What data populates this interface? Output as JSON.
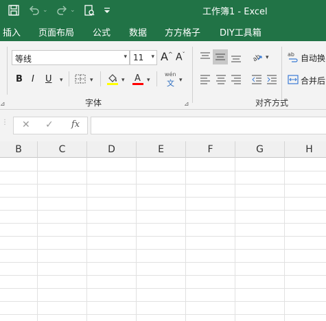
{
  "titlebar": {
    "doc_title": "工作簿1 - Excel",
    "quick_access": [
      "save-icon",
      "undo-icon",
      "redo-icon",
      "print-preview-icon",
      "customize-icon"
    ]
  },
  "menu": {
    "tabs": [
      "插入",
      "页面布局",
      "公式",
      "数据",
      "方方格子",
      "DIY工具箱"
    ]
  },
  "font_group": {
    "font_name": "等线",
    "font_size": "11",
    "label": "字体",
    "bold": "B",
    "italic": "I",
    "underline": "U",
    "grow_label": "A",
    "shrink_label": "A",
    "phonetic_top": "wén",
    "phonetic_bottom": "文",
    "fill_color": "#ffff00",
    "font_color": "#ff0000"
  },
  "align_group": {
    "label": "对齐方式",
    "wrap_label": "自动换",
    "merge_label": "合并后",
    "orient_label": "ab"
  },
  "formula_bar": {
    "cancel": "✕",
    "enter": "✓",
    "fx": "fx",
    "value": ""
  },
  "grid": {
    "columns": [
      "B",
      "C",
      "D",
      "E",
      "F",
      "G",
      "H"
    ]
  },
  "colors": {
    "brand": "#217346",
    "ribbon": "#f3f3f3",
    "gridline": "#e1e1e1",
    "selected_button": "#c8c8c8"
  }
}
